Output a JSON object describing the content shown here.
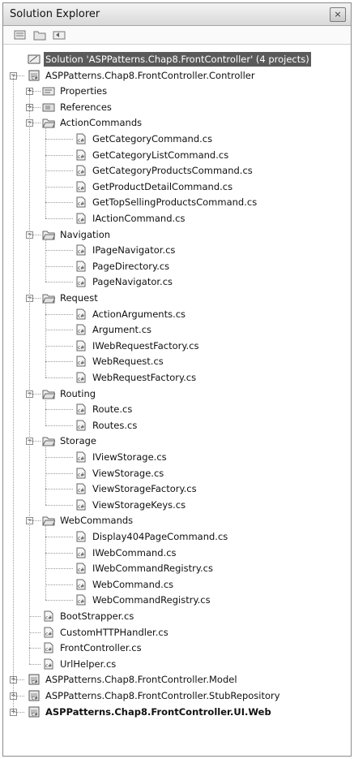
{
  "window": {
    "title": "Solution Explorer",
    "close_glyph": "×"
  },
  "toolbar": {
    "buttons": [
      "properties-icon",
      "show-all-files-icon",
      "refresh-icon"
    ]
  },
  "tree": [
    {
      "level": 0,
      "type": "solution",
      "label": "Solution 'ASPPatterns.Chap8.FrontController' (4 projects)",
      "selected": true,
      "expander": ""
    },
    {
      "level": 0,
      "type": "project",
      "label": "ASPPatterns.Chap8.FrontController.Controller",
      "expander": "−"
    },
    {
      "level": 1,
      "type": "properties",
      "label": "Properties",
      "expander": "+"
    },
    {
      "level": 1,
      "type": "references",
      "label": "References",
      "expander": "+"
    },
    {
      "level": 1,
      "type": "folder",
      "label": "ActionCommands",
      "expander": "−"
    },
    {
      "level": 2,
      "type": "file",
      "label": "GetCategoryCommand.cs"
    },
    {
      "level": 2,
      "type": "file",
      "label": "GetCategoryListCommand.cs"
    },
    {
      "level": 2,
      "type": "file",
      "label": "GetCategoryProductsCommand.cs"
    },
    {
      "level": 2,
      "type": "file",
      "label": "GetProductDetailCommand.cs"
    },
    {
      "level": 2,
      "type": "file",
      "label": "GetTopSellingProductsCommand.cs"
    },
    {
      "level": 2,
      "type": "file",
      "label": "IActionCommand.cs"
    },
    {
      "level": 1,
      "type": "folder",
      "label": "Navigation",
      "expander": "−"
    },
    {
      "level": 2,
      "type": "file",
      "label": "IPageNavigator.cs"
    },
    {
      "level": 2,
      "type": "file",
      "label": "PageDirectory.cs"
    },
    {
      "level": 2,
      "type": "file",
      "label": "PageNavigator.cs"
    },
    {
      "level": 1,
      "type": "folder",
      "label": "Request",
      "expander": "−"
    },
    {
      "level": 2,
      "type": "file",
      "label": "ActionArguments.cs"
    },
    {
      "level": 2,
      "type": "file",
      "label": "Argument.cs"
    },
    {
      "level": 2,
      "type": "file",
      "label": "IWebRequestFactory.cs"
    },
    {
      "level": 2,
      "type": "file",
      "label": "WebRequest.cs"
    },
    {
      "level": 2,
      "type": "file",
      "label": "WebRequestFactory.cs"
    },
    {
      "level": 1,
      "type": "folder",
      "label": "Routing",
      "expander": "−"
    },
    {
      "level": 2,
      "type": "file",
      "label": "Route.cs"
    },
    {
      "level": 2,
      "type": "file",
      "label": "Routes.cs"
    },
    {
      "level": 1,
      "type": "folder",
      "label": "Storage",
      "expander": "−"
    },
    {
      "level": 2,
      "type": "file",
      "label": "IViewStorage.cs"
    },
    {
      "level": 2,
      "type": "file",
      "label": "ViewStorage.cs"
    },
    {
      "level": 2,
      "type": "file",
      "label": "ViewStorageFactory.cs"
    },
    {
      "level": 2,
      "type": "file",
      "label": "ViewStorageKeys.cs"
    },
    {
      "level": 1,
      "type": "folder",
      "label": "WebCommands",
      "expander": "−"
    },
    {
      "level": 2,
      "type": "file",
      "label": "Display404PageCommand.cs"
    },
    {
      "level": 2,
      "type": "file",
      "label": "IWebCommand.cs"
    },
    {
      "level": 2,
      "type": "file",
      "label": "IWebCommandRegistry.cs"
    },
    {
      "level": 2,
      "type": "file",
      "label": "WebCommand.cs"
    },
    {
      "level": 2,
      "type": "file",
      "label": "WebCommandRegistry.cs"
    },
    {
      "level": 1,
      "type": "file",
      "label": "BootStrapper.cs"
    },
    {
      "level": 1,
      "type": "file",
      "label": "CustomHTTPHandler.cs"
    },
    {
      "level": 1,
      "type": "file",
      "label": "FrontController.cs"
    },
    {
      "level": 1,
      "type": "file",
      "label": "UrlHelper.cs"
    },
    {
      "level": 0,
      "type": "project",
      "label": "ASPPatterns.Chap8.FrontController.Model",
      "expander": "+"
    },
    {
      "level": 0,
      "type": "project",
      "label": "ASPPatterns.Chap8.FrontController.StubRepository",
      "expander": "+"
    },
    {
      "level": 0,
      "type": "webproject",
      "label": "ASPPatterns.Chap8.FrontController.UI.Web",
      "expander": "+",
      "bold": true
    }
  ]
}
